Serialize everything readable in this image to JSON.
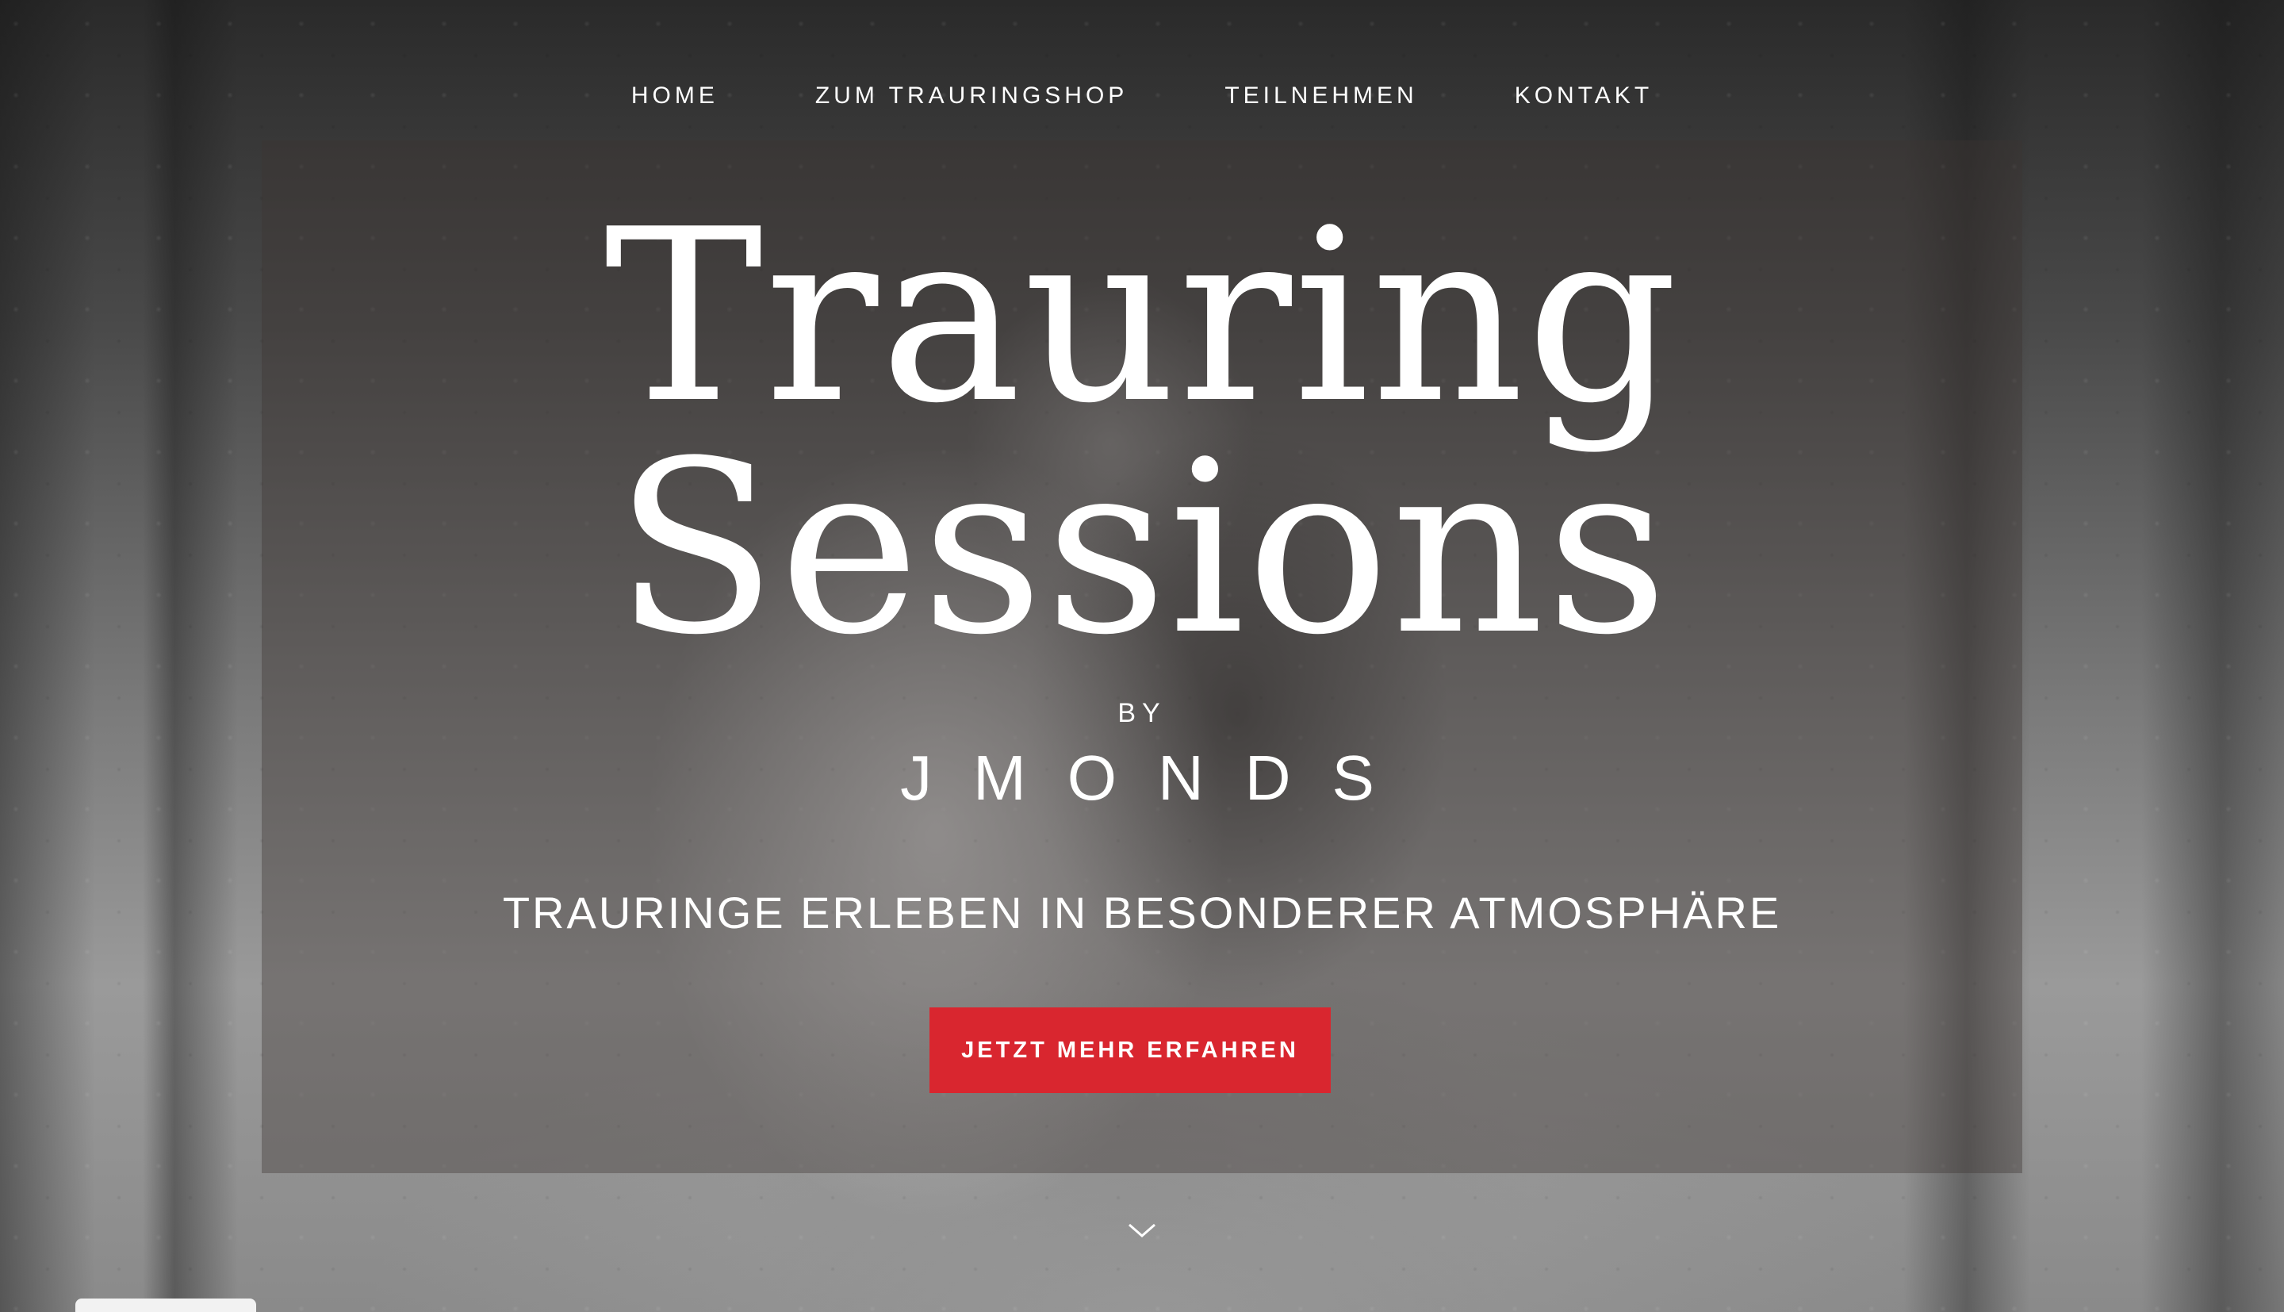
{
  "nav": {
    "items": [
      {
        "label": "HOME"
      },
      {
        "label": "ZUM TRAURINGSHOP"
      },
      {
        "label": "TEILNEHMEN"
      },
      {
        "label": "KONTAKT"
      }
    ]
  },
  "hero": {
    "title_line1": "Trauring",
    "title_line2": "Sessions",
    "by": "BY",
    "brand": "JMONDS",
    "subtitle": "TRAURINGE ERLEBEN IN BESONDERER ATMOSPHÄRE",
    "cta_label": "JETZT MEHR ERFAHREN",
    "scroll_icon": "chevron-down-icon"
  },
  "colors": {
    "accent": "#d9262f",
    "text": "#ffffff",
    "overlay": "rgba(60,52,50,0.38)"
  }
}
